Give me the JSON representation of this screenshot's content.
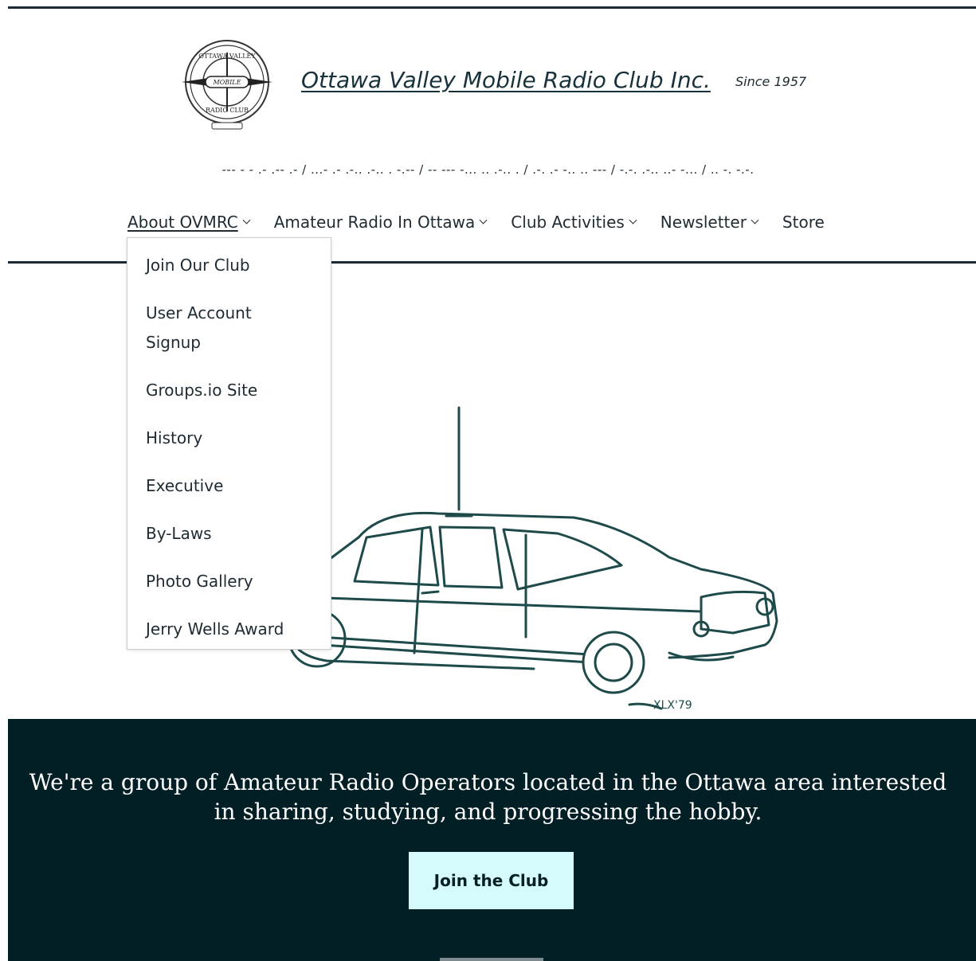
{
  "header": {
    "title": "Ottawa Valley Mobile Radio Club Inc.",
    "tagline": "Since 1957",
    "morse": "--- - - .- .-- .- / ...- .- .-.. .-.. . -.-- / -- --- -... .. .-.. . / .-. .- -.. .. --- / -.-. .-.. ..- -... / .. -. -.-.",
    "logo_text": {
      "top": "OTTAWA VALLEY",
      "center": "MOBILE",
      "bottom": "RADIO CLUB"
    }
  },
  "nav": {
    "items": [
      {
        "label": "About OVMRC",
        "has_dropdown": true,
        "active": true
      },
      {
        "label": "Amateur Radio In Ottawa",
        "has_dropdown": true
      },
      {
        "label": "Club Activities",
        "has_dropdown": true
      },
      {
        "label": "Newsletter",
        "has_dropdown": true
      },
      {
        "label": "Store",
        "has_dropdown": false
      }
    ]
  },
  "dropdown": {
    "items": [
      "Join Our Club",
      "User Account Signup",
      "Groups.io Site",
      "History",
      "Executive",
      "By-Laws",
      "Photo Gallery",
      "Jerry Wells Award"
    ]
  },
  "hero": {
    "signature": "XLX'79",
    "icon": "car-illustration"
  },
  "footer": {
    "mission": "We're a group of Amateur Radio Operators located in the Ottawa area interested in sharing, studying, and progressing the hobby.",
    "cta_label": "Join the Club"
  },
  "colors": {
    "text": "#1e2b33",
    "footer_bg": "#021f26",
    "button_bg": "#d6fbfd",
    "lines": "#1e2b33"
  }
}
